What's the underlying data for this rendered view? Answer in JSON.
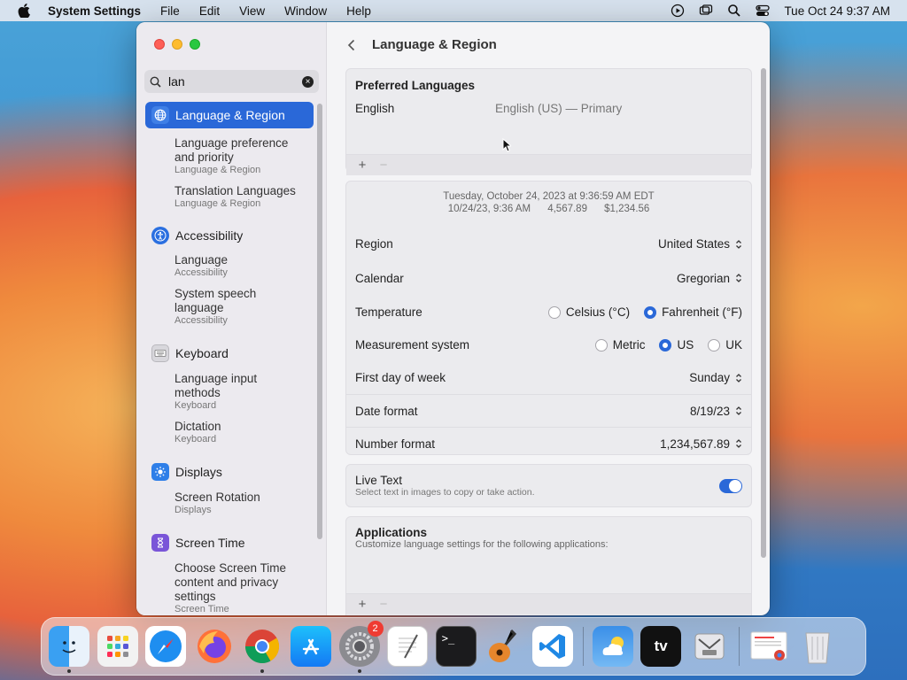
{
  "menubar": {
    "app_name": "System Settings",
    "items": [
      "File",
      "Edit",
      "View",
      "Window",
      "Help"
    ],
    "clock": "Tue Oct 24  9:37 AM"
  },
  "sidebar": {
    "search": {
      "value": "lan",
      "placeholder": "Search"
    },
    "groups": [
      {
        "category": "Language & Region",
        "icon": "globe-icon",
        "active": true,
        "subs": [
          {
            "title": "Language preference and priority",
            "section": "Language & Region"
          },
          {
            "title": "Translation Languages",
            "section": "Language & Region"
          }
        ]
      },
      {
        "category": "Accessibility",
        "icon": "accessibility-icon",
        "subs": [
          {
            "title": "Language",
            "section": "Accessibility"
          },
          {
            "title": "System speech language",
            "section": "Accessibility"
          }
        ]
      },
      {
        "category": "Keyboard",
        "icon": "keyboard-icon",
        "subs": [
          {
            "title": "Language input methods",
            "section": "Keyboard"
          },
          {
            "title": "Dictation",
            "section": "Keyboard"
          }
        ]
      },
      {
        "category": "Displays",
        "icon": "sun-icon",
        "subs": [
          {
            "title": "Screen Rotation",
            "section": "Displays"
          }
        ]
      },
      {
        "category": "Screen Time",
        "icon": "hourglass-icon",
        "subs": [
          {
            "title": "Choose Screen Time content and privacy settings",
            "section": "Screen Time"
          }
        ]
      }
    ]
  },
  "content": {
    "title": "Language & Region",
    "preferred": {
      "header": "Preferred Languages",
      "language": "English",
      "language_detail": "English (US) — Primary",
      "add": "+",
      "remove": "−"
    },
    "sample": {
      "line1": "Tuesday, October 24, 2023 at 9:36:59 AM EDT",
      "line2": "10/24/23, 9:36 AM      4,567.89      $1,234.56"
    },
    "region": {
      "label": "Region",
      "value": "United States"
    },
    "calendar": {
      "label": "Calendar",
      "value": "Gregorian"
    },
    "temperature": {
      "label": "Temperature",
      "options": [
        "Celsius (°C)",
        "Fahrenheit (°F)"
      ],
      "selected": "Fahrenheit (°F)"
    },
    "measurement": {
      "label": "Measurement system",
      "options": [
        "Metric",
        "US",
        "UK"
      ],
      "selected": "US"
    },
    "first_day": {
      "label": "First day of week",
      "value": "Sunday"
    },
    "date_format": {
      "label": "Date format",
      "value": "8/19/23"
    },
    "number_format": {
      "label": "Number format",
      "value": "1,234,567.89"
    },
    "live_text": {
      "label": "Live Text",
      "description": "Select text in images to copy or take action.",
      "enabled": true
    },
    "applications": {
      "header": "Applications",
      "description": "Customize language settings for the following applications:",
      "add": "+",
      "remove": "−"
    }
  },
  "dock": {
    "apps": [
      "Finder",
      "Launchpad",
      "Safari",
      "Firefox",
      "Chrome",
      "App Store",
      "System Settings",
      "TextEdit",
      "Terminal",
      "GarageBand",
      "VS Code",
      "Weather",
      "TV",
      "Migration Assistant",
      "Documents",
      "Trash"
    ],
    "settings_badge": "2",
    "terminal_label": ">_",
    "tv_label": "tv"
  },
  "colors": {
    "accent": "#2a68d8",
    "window_bg": "#f4f4f6",
    "sidebar_bg": "#eceaef"
  }
}
